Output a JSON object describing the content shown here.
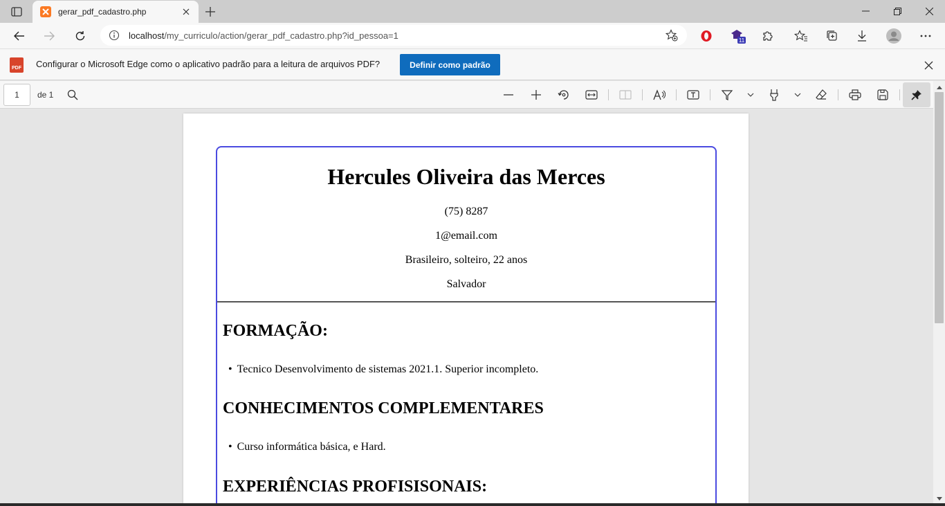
{
  "browser": {
    "tab_title": "gerar_pdf_cadastro.php",
    "url_host": "localhost",
    "url_path": "/my_curriculo/action/gerar_pdf_cadastro.php?id_pessoa=1",
    "ext_badge": "11"
  },
  "infobar": {
    "message": "Configurar o Microsoft Edge como o aplicativo padrão para a leitura de arquivos PDF?",
    "button_label": "Definir como padrão",
    "badge_text": "PDF"
  },
  "pdf_toolbar": {
    "page_number": "1",
    "page_of": "de 1"
  },
  "resume": {
    "name": "Hercules Oliveira das Merces",
    "phone": "(75) 8287",
    "email": "1@email.com",
    "personal": "Brasileiro, solteiro, 22 anos",
    "city": "Salvador",
    "section_formacao": "FORMAÇÃO:",
    "formacao_item": "Tecnico Desenvolvimento de sistemas 2021.1. Superior incompleto.",
    "section_conhecimentos": "CONHECIMENTOS COMPLEMENTARES",
    "conhecimentos_item": "Curso informática básica, e Hard.",
    "section_experiencias": "EXPERIÊNCIAS PROFISISONAIS:"
  },
  "colors": {
    "accent": "#0f6cbd",
    "cv_border": "#4a4ae0",
    "tab_favicon": "#fb7a24"
  }
}
